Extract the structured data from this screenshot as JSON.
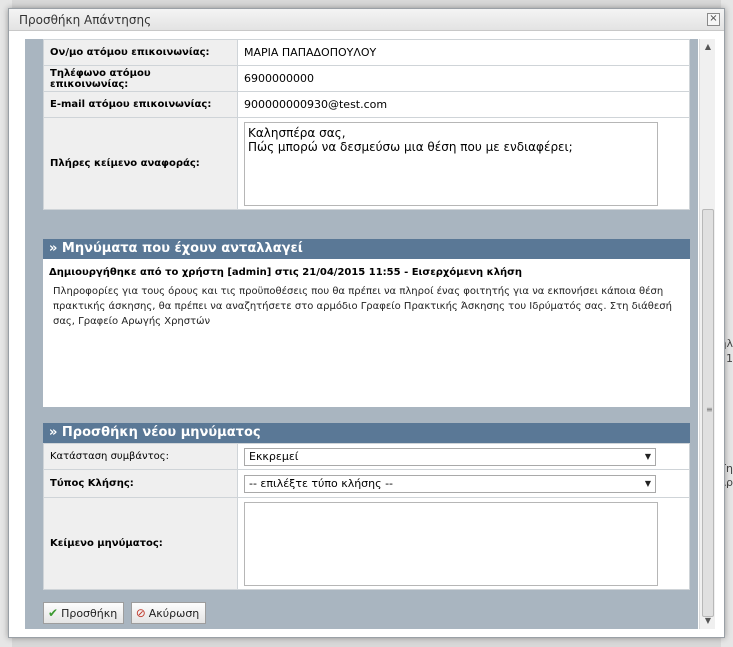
{
  "dialog": {
    "title": "Προσθήκη Απάντησης",
    "close_glyph": "×"
  },
  "contact": {
    "rows": [
      {
        "label": "Ον/μο ατόμου επικοινωνίας:",
        "value": "ΜΑΡΙΑ ΠΑΠΑΔΟΠΟΥΛΟΥ"
      },
      {
        "label": "Τηλέφωνο ατόμου επικοινωνίας:",
        "value": "6900000000"
      },
      {
        "label": "E-mail ατόμου επικοινωνίας:",
        "value": "900000000930@test.com"
      }
    ],
    "full_text_label": "Πλήρες κείμενο αναφοράς:",
    "full_text": "Καλησπέρα σας,\nΠώς μπορώ να δεσμεύσω μια θέση που με ενδιαφέρει;"
  },
  "messages": {
    "heading": "» Μηνύματα που έχουν ανταλλαγεί",
    "meta": "Δημιουργήθηκε από το χρήστη [admin] στις 21/04/2015 11:55 - Εισερχόμενη κλήση",
    "body": "Πληροφορίες για τους όρους και τις προϋποθέσεις που θα πρέπει να πληροί ένας φοιτητής για να εκπονήσει κάποια θέση πρακτικής άσκησης, θα πρέπει να αναζητήσετε στο αρμόδιο Γραφείο Πρακτικής Άσκησης του Ιδρύματός σας. Στη διάθεσή σας, Γραφείο Αρωγής Χρηστών"
  },
  "new_message": {
    "heading": "» Προσθήκη νέου μηνύματος",
    "status_label": "Κατάσταση συμβάντος:",
    "status_value": "Εκκρεμεί",
    "call_type_label": "Τύπος Κλήσης:",
    "call_type_value": "-- επιλέξτε τύπο κλήσης --",
    "message_label": "Κείμενο μηνύματος:",
    "message_value": ""
  },
  "buttons": {
    "add": "Προσθήκη",
    "cancel": "Ακύρωση"
  },
  "backdrop": {
    "right_fragments": [
      "τηλ",
      "1",
      "Τη",
      "Άρ"
    ]
  }
}
